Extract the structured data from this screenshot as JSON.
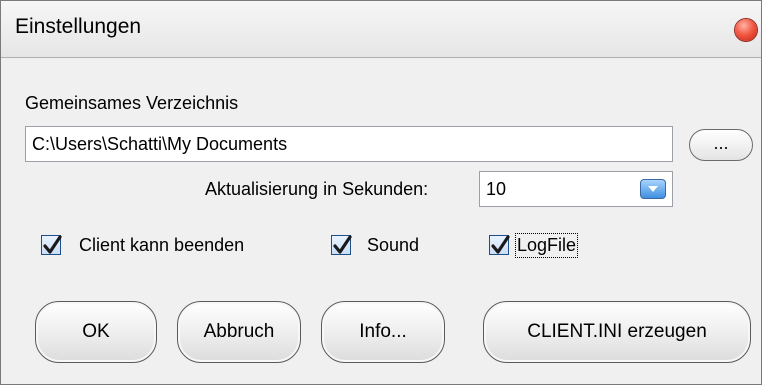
{
  "window": {
    "title": "Einstellungen"
  },
  "shared_dir": {
    "label": "Gemeinsames Verzeichnis",
    "value": "C:\\Users\\Schatti\\My Documents",
    "browse_label": "..."
  },
  "refresh": {
    "label": "Aktualisierung in Sekunden:",
    "value": "10"
  },
  "options": [
    {
      "label": "Client kann beenden",
      "checked": true
    },
    {
      "label": "Sound",
      "checked": true
    },
    {
      "label": "LogFile",
      "checked": true
    }
  ],
  "buttons": {
    "ok": "OK",
    "cancel": "Abbruch",
    "info": "Info...",
    "create_ini": "CLIENT.INI erzeugen"
  },
  "colors": {
    "close_button": "#e8412f",
    "checkbox_accent": "#1f4f8a"
  }
}
